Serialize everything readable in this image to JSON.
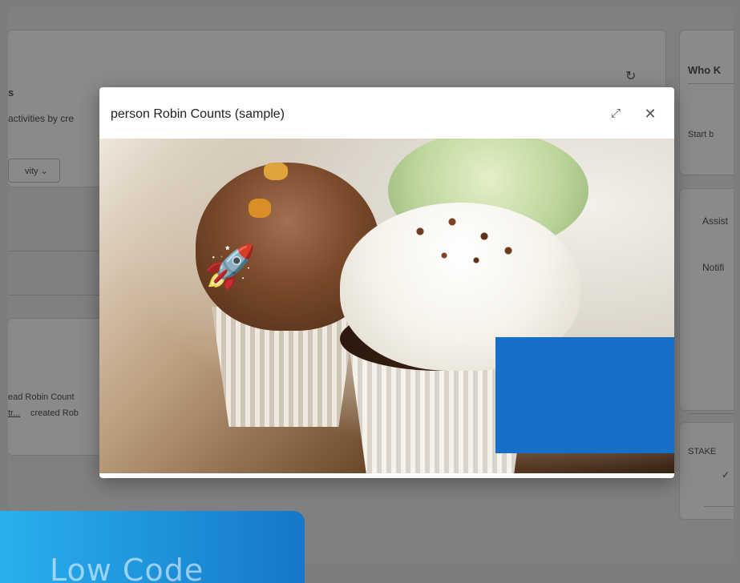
{
  "background": {
    "left_heading": "s",
    "left_subtext": "activities by cre",
    "filter_label": "vity",
    "activity_line_1": "ead Robin Count",
    "activity_line_2_link": "tr...",
    "activity_line_2_rest": "created Rob",
    "right_card_title": "Who K",
    "right_card_text": "Start b",
    "assist_label": "Assist",
    "notif_label": "Notifi",
    "stake_label": "STAKE",
    "check_mark": "✓"
  },
  "modal": {
    "title": "person Robin Counts (sample)",
    "expand_icon": "⤢",
    "close_icon": "✕"
  },
  "image": {
    "rocket_emoji": "🚀"
  },
  "banner": {
    "text": "Low Code"
  },
  "colors": {
    "accent_blue": "#1770c7",
    "banner_start": "#28b0ee",
    "banner_end": "#1577c9"
  }
}
